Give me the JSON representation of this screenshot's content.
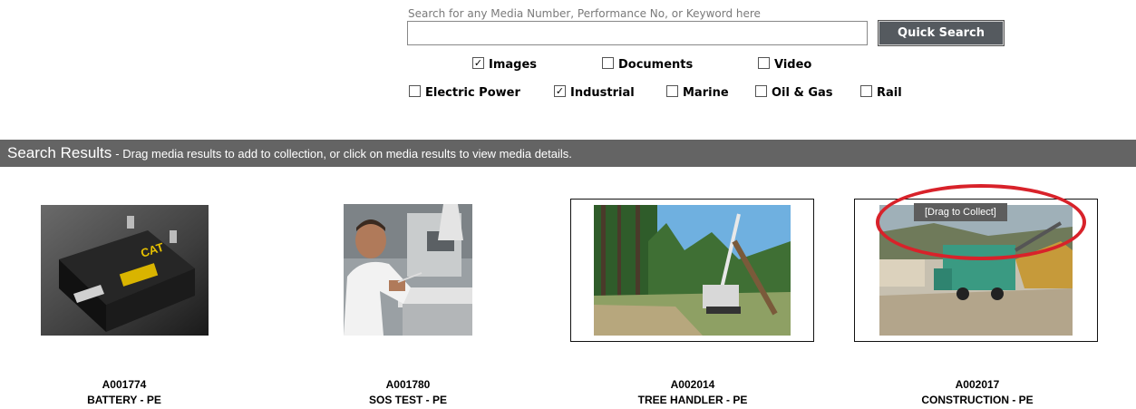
{
  "search": {
    "hint": "Search for any Media Number, Performance No, or Keyword here",
    "value": "",
    "button_label": "Quick Search"
  },
  "media_types": [
    {
      "label": "Images",
      "checked": true
    },
    {
      "label": "Documents",
      "checked": false
    },
    {
      "label": "Video",
      "checked": false
    }
  ],
  "industries": [
    {
      "label": "Electric Power",
      "checked": false
    },
    {
      "label": "Industrial",
      "checked": true
    },
    {
      "label": "Marine",
      "checked": false
    },
    {
      "label": "Oil & Gas",
      "checked": false
    },
    {
      "label": "Rail",
      "checked": false
    }
  ],
  "results_header": {
    "title": "Search Results",
    "subtitle": "- Drag media results to add to collection, or click on media results to view media details."
  },
  "results": [
    {
      "id": "A001774",
      "title": "BATTERY - PE",
      "thumb": "battery-image"
    },
    {
      "id": "A001780",
      "title": "SOS TEST - PE",
      "thumb": "lab-test-image"
    },
    {
      "id": "A002014",
      "title": "TREE HANDLER - PE",
      "thumb": "tree-handler-image"
    },
    {
      "id": "A002017",
      "title": "CONSTRUCTION - PE",
      "thumb": "construction-image"
    }
  ],
  "drag_tooltip": "[Drag to Collect]",
  "colors": {
    "highlight": "#d8222a",
    "header_bg": "#646464",
    "button_bg": "#555a5f"
  }
}
